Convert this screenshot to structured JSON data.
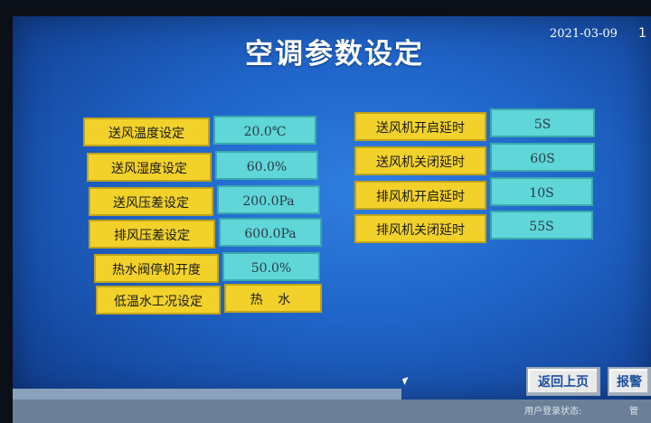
{
  "header": {
    "title": "空调参数设定",
    "date": "2021-03-09",
    "edge_char": "1"
  },
  "left_params": [
    {
      "label": "送风温度设定",
      "value": "20.0℃"
    },
    {
      "label": "送风湿度设定",
      "value": "60.0%"
    },
    {
      "label": "送风压差设定",
      "value": "200.0Pa"
    },
    {
      "label": "排风压差设定",
      "value": "600.0Pa"
    },
    {
      "label": "热水阀停机开度",
      "value": "50.0%"
    },
    {
      "label": "低温水工况设定",
      "value": "热 水"
    }
  ],
  "right_params": [
    {
      "label": "送风机开启延时",
      "value": "5S"
    },
    {
      "label": "送风机关闭延时",
      "value": "60S"
    },
    {
      "label": "排风机开启延时",
      "value": "10S"
    },
    {
      "label": "排风机关闭延时",
      "value": "55S"
    }
  ],
  "buttons": {
    "back": "返回上页",
    "alarm": "报警"
  },
  "status": {
    "text": "用户登录状态:",
    "value": "管"
  },
  "colors": {
    "label_bg": "#f2d22a",
    "value_bg": "#5fd6d8",
    "screen_bg": "#1f63c7"
  }
}
